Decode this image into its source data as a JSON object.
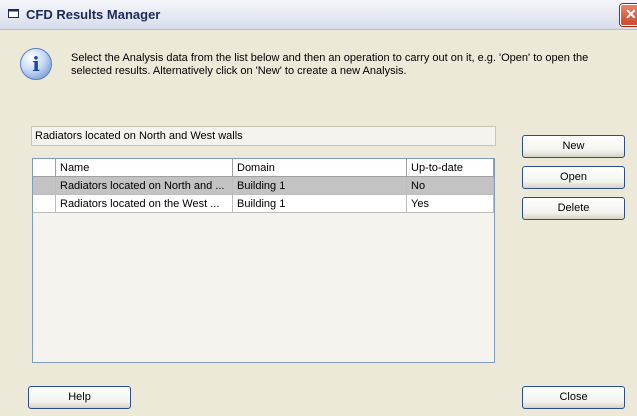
{
  "window": {
    "title": "CFD Results Manager",
    "close_glyph": "✕"
  },
  "intro": "Select the Analysis data from the list below and then an operation to carry out on it, e.g. 'Open' to open the selected results. Alternatively click on 'New' to create a new Analysis.",
  "selected_name": "Radiators located on North and West walls",
  "table": {
    "columns": [
      "Name",
      "Domain",
      "Up-to-date"
    ],
    "rows": [
      {
        "name": "Radiators located on North and ...",
        "domain": "Building 1",
        "uptodate": "No",
        "selected": true
      },
      {
        "name": "Radiators located on the West ...",
        "domain": "Building 1",
        "uptodate": "Yes",
        "selected": false
      }
    ]
  },
  "buttons": {
    "new": "New",
    "open": "Open",
    "delete": "Delete",
    "help": "Help",
    "close": "Close"
  },
  "icons": {
    "title": "window-icon",
    "info": "info-icon"
  }
}
